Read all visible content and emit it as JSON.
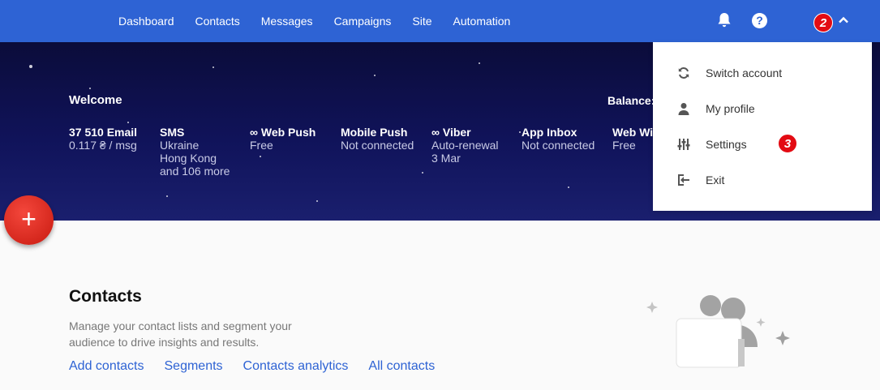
{
  "nav": {
    "items": [
      "Dashboard",
      "Contacts",
      "Messages",
      "Campaigns",
      "Site",
      "Automation"
    ],
    "badge_step": "2"
  },
  "hero": {
    "welcome": "Welcome",
    "balance_label": "Balance:",
    "channels": [
      {
        "title": "37 510    Email",
        "sub": [
          "0.117 ₴ / msg"
        ]
      },
      {
        "title": "SMS",
        "sub": [
          "Ukraine",
          "Hong Kong",
          "and 106 more"
        ]
      },
      {
        "title": "∞ Web Push",
        "sub": [
          "Free"
        ]
      },
      {
        "title": "Mobile Push",
        "sub": [
          "Not connected"
        ]
      },
      {
        "title": "∞ Viber",
        "sub": [
          "Auto-renewal",
          "3 Mar"
        ]
      },
      {
        "title": "App Inbox",
        "sub": [
          "Not connected"
        ]
      },
      {
        "title": "Web Wid",
        "sub": [
          "Free"
        ]
      }
    ]
  },
  "fab": {
    "label": "+"
  },
  "account_menu": {
    "items": [
      {
        "label": "Switch account",
        "icon": "switch-icon"
      },
      {
        "label": "My profile",
        "icon": "person-icon"
      },
      {
        "label": "Settings",
        "icon": "sliders-icon"
      },
      {
        "label": "Exit",
        "icon": "exit-icon"
      }
    ],
    "settings_badge": "3"
  },
  "contacts": {
    "title": "Contacts",
    "description": "Manage your contact lists and segment your audience to drive insights and results.",
    "links": [
      "Add contacts",
      "Segments",
      "Contacts analytics",
      "All contacts"
    ]
  },
  "colors": {
    "topbar": "#2e63d4",
    "badge": "#e30b13",
    "link": "#2e63d4",
    "fab": "#e0281d"
  }
}
